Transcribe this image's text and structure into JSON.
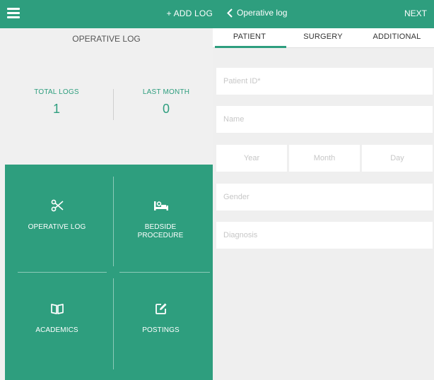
{
  "left_header": {
    "menu_icon": "hamburger-icon",
    "add_log_label": "+ ADD LOG"
  },
  "section_title": "OPERATIVE LOG",
  "stats": [
    {
      "label": "TOTAL LOGS",
      "value": "1"
    },
    {
      "label": "LAST MONTH",
      "value": "0"
    }
  ],
  "tiles": [
    {
      "label": "OPERATIVE LOG",
      "icon": "scissors-icon"
    },
    {
      "label": "BEDSIDE PROCEDURE",
      "icon": "bed-icon"
    },
    {
      "label": "ACADEMICS",
      "icon": "book-icon"
    },
    {
      "label": "POSTINGS",
      "icon": "edit-icon"
    }
  ],
  "right_header": {
    "back_label": "Operative log",
    "back_icon": "chevron-left-icon",
    "next_label": "NEXT"
  },
  "tabs": [
    {
      "label": "PATIENT",
      "active": true
    },
    {
      "label": "SURGERY",
      "active": false
    },
    {
      "label": "ADDITIONAL",
      "active": false
    }
  ],
  "form": {
    "patient_id_placeholder": "Patient ID*",
    "name_placeholder": "Name",
    "year_placeholder": "Year",
    "month_placeholder": "Month",
    "day_placeholder": "Day",
    "gender_placeholder": "Gender",
    "diagnosis_placeholder": "Diagnosis"
  },
  "colors": {
    "brand": "#2e9e7e",
    "background": "#efefef",
    "placeholder": "#c7c7c7"
  }
}
